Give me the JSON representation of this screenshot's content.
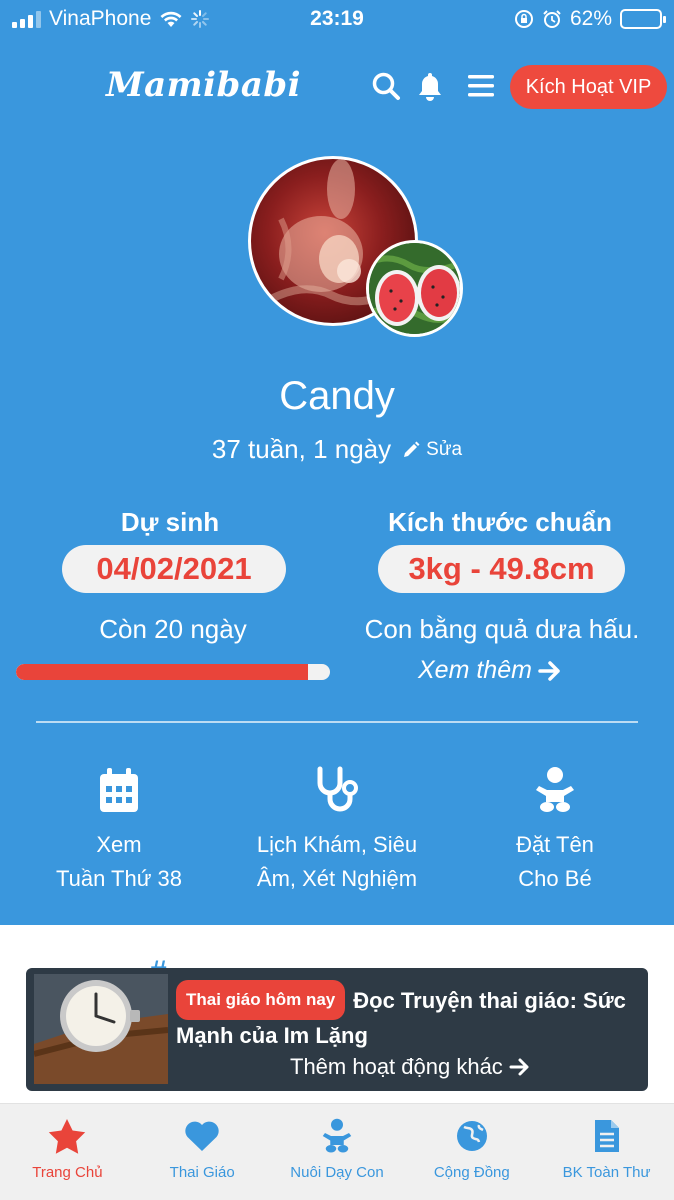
{
  "status_bar": {
    "carrier": "VinaPhone",
    "time": "23:19",
    "battery": "62%"
  },
  "header": {
    "logo": "Mamibabi",
    "vip_button": "Kích Hoạt VIP"
  },
  "profile": {
    "name": "Candy",
    "age": "37 tuần, 1 ngày",
    "edit_label": "Sửa"
  },
  "due_date": {
    "title": "Dự sinh",
    "date": "04/02/2021",
    "remaining": "Còn 20 ngày",
    "progress_fraction": 0.93
  },
  "size": {
    "title": "Kích thước chuẩn",
    "value": "3kg - 49.8cm",
    "comparison": "Con bằng quả dưa hấu.",
    "more_link": "Xem thêm"
  },
  "features": [
    {
      "line1": "Xem",
      "line2": "Tuần Thứ 38",
      "icon": "calendar-icon"
    },
    {
      "line1": "Lịch Khám, Siêu",
      "line2": "Âm, Xét Nghiệm",
      "icon": "stethoscope-icon"
    },
    {
      "line1": "Đặt Tên",
      "line2": "Cho Bé",
      "icon": "baby-icon"
    }
  ],
  "banner": {
    "tag": "Thai giáo hôm nay",
    "headline": "Đọc Truyện thai giáo: Sức Mạnh của Im Lặng",
    "link": "Thêm hoạt động khác"
  },
  "tabs": [
    {
      "label": "Trang Chủ",
      "icon": "star-icon",
      "active": true
    },
    {
      "label": "Thai Giáo",
      "icon": "heart-icon",
      "active": false
    },
    {
      "label": "Nuôi Dạy Con",
      "icon": "baby-icon",
      "active": false
    },
    {
      "label": "Cộng Đồng",
      "icon": "globe-icon",
      "active": false
    },
    {
      "label": "BK Toàn Thư",
      "icon": "document-icon",
      "active": false
    }
  ],
  "colors": {
    "brand_blue": "#3a97dd",
    "accent_red": "#e9443a",
    "vip_red": "#ee4a3e",
    "banner_dark": "#2e3a45"
  }
}
